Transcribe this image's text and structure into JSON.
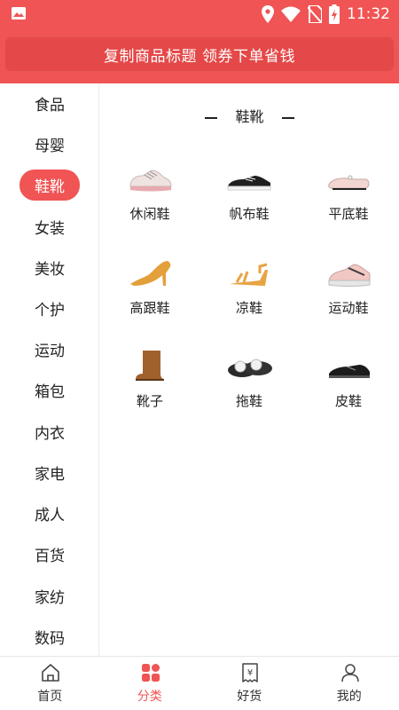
{
  "status_bar": {
    "time": "11:32",
    "icons": [
      "image-icon",
      "location-icon",
      "wifi-icon",
      "no-sim-icon",
      "battery-charging-icon"
    ]
  },
  "banner": {
    "text": "复制商品标题 领券下单省钱"
  },
  "sidebar": {
    "active_index": 2,
    "items": [
      {
        "label": "食品"
      },
      {
        "label": "母婴"
      },
      {
        "label": "鞋靴"
      },
      {
        "label": "女装"
      },
      {
        "label": "美妆"
      },
      {
        "label": "个护"
      },
      {
        "label": "运动"
      },
      {
        "label": "箱包"
      },
      {
        "label": "内衣"
      },
      {
        "label": "家电"
      },
      {
        "label": "成人"
      },
      {
        "label": "百货"
      },
      {
        "label": "家纺"
      },
      {
        "label": "数码"
      }
    ]
  },
  "content": {
    "section_title": "鞋靴",
    "categories": [
      {
        "label": "休闲鞋",
        "icon": "casual-shoe-icon"
      },
      {
        "label": "帆布鞋",
        "icon": "canvas-shoe-icon"
      },
      {
        "label": "平底鞋",
        "icon": "flat-shoe-icon"
      },
      {
        "label": "高跟鞋",
        "icon": "high-heel-icon"
      },
      {
        "label": "凉鞋",
        "icon": "sandal-icon"
      },
      {
        "label": "运动鞋",
        "icon": "sneaker-icon"
      },
      {
        "label": "靴子",
        "icon": "boot-icon"
      },
      {
        "label": "拖鞋",
        "icon": "slipper-icon"
      },
      {
        "label": "皮鞋",
        "icon": "leather-shoe-icon"
      }
    ]
  },
  "bottom_nav": {
    "active_index": 1,
    "items": [
      {
        "label": "首页",
        "icon": "home-icon"
      },
      {
        "label": "分类",
        "icon": "category-icon"
      },
      {
        "label": "好货",
        "icon": "goods-icon"
      },
      {
        "label": "我的",
        "icon": "profile-icon"
      }
    ]
  },
  "colors": {
    "accent": "#f05454",
    "banner": "#e54848"
  }
}
